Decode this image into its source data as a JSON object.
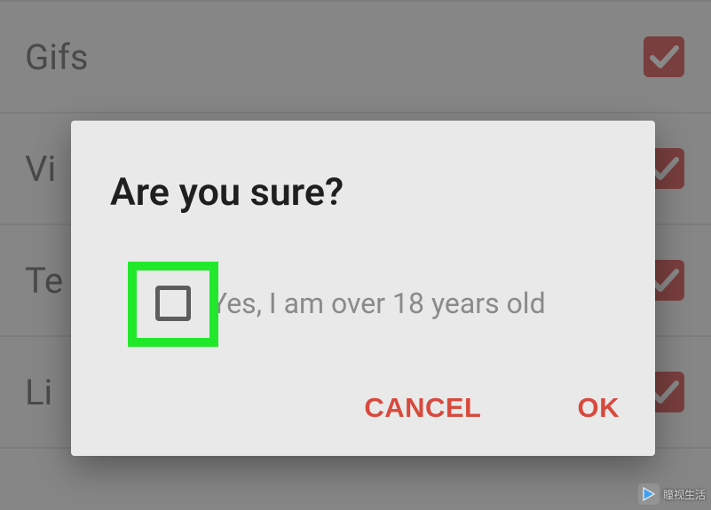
{
  "background": {
    "list_items": [
      {
        "label": "Gifs",
        "checked": true
      },
      {
        "label": "Vi",
        "checked": true
      },
      {
        "label": "Te",
        "checked": true
      },
      {
        "label": "Li",
        "checked": true
      }
    ]
  },
  "dialog": {
    "title": "Are you sure?",
    "checkbox_checked": false,
    "confirm_label": "Yes, I am over 18 years old",
    "cancel_label": "CANCEL",
    "ok_label": "OK"
  },
  "watermark": {
    "text": "瞳视生活"
  },
  "colors": {
    "accent": "#d53c3c",
    "action": "#d74a3d",
    "highlight": "#22e82c"
  }
}
